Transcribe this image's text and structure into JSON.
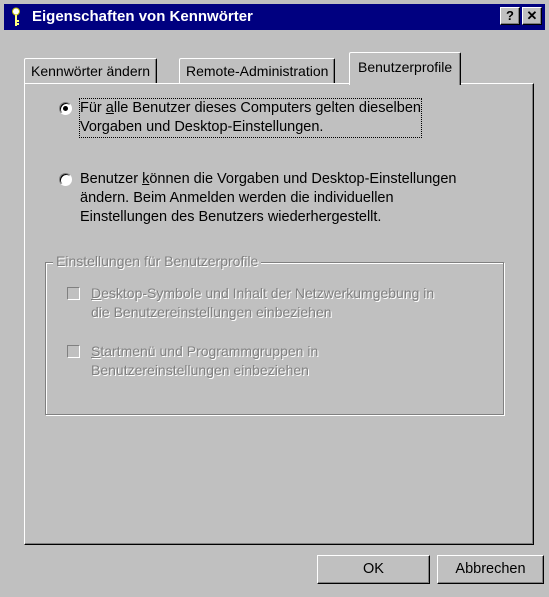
{
  "window": {
    "title": "Eigenschaften von Kennwörter",
    "help_button": "?",
    "close_button": "✕",
    "title_bar_color": "#000080",
    "face_color": "#c0c0c0"
  },
  "tabs": [
    {
      "label": "Kennwörter ändern",
      "active": false
    },
    {
      "label": "Remote-Administration",
      "active": false
    },
    {
      "label": "Benutzerprofile",
      "active": true
    }
  ],
  "profile_options": {
    "selected": 0,
    "option_same": {
      "line1_pre": "Für ",
      "line1_key": "a",
      "line1_post": "lle Benutzer dieses Computers gelten dieselben",
      "line2": "Vorgaben und Desktop-Einstellungen."
    },
    "option_individual": {
      "line1_pre": "Benutzer ",
      "line1_key": "k",
      "line1_post": "önnen die Vorgaben und Desktop-Einstellungen",
      "line2": "ändern. Beim Anmelden werden die individuellen",
      "line3": "Einstellungen des Benutzers wiederhergestellt."
    }
  },
  "settings_group": {
    "label": "Einstellungen für Benutzerprofile",
    "enabled": false,
    "checkbox_desktop": {
      "line1_key": "D",
      "line1_post": "esktop-Symbole und Inhalt der Netzwerkumgebung in",
      "line2": "die Benutzereinstellungen einbeziehen",
      "checked": false
    },
    "checkbox_startmenu": {
      "line1_key": "S",
      "line1_post": "tartmenü und Programmgruppen in",
      "line2": "Benutzereinstellungen einbeziehen",
      "checked": false
    }
  },
  "buttons": {
    "ok": "OK",
    "cancel": "Abbrechen"
  }
}
